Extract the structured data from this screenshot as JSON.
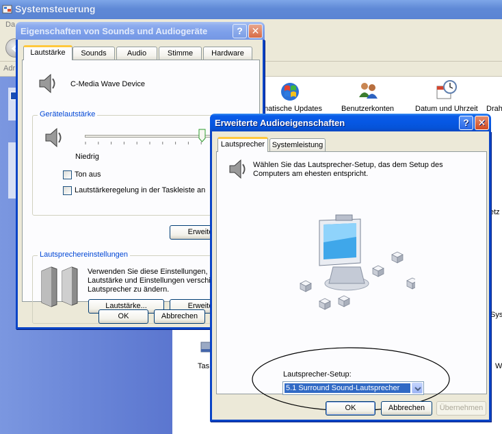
{
  "control_panel": {
    "title": "Systemsteuerung",
    "menu_partial": "Da",
    "address_partial": "Adr",
    "icons": [
      {
        "label": "matische Updates"
      },
      {
        "label": "Benutzerkonten"
      },
      {
        "label": "Datum und Uhrzeit"
      },
      {
        "label": "Drah"
      }
    ],
    "partial_labels": {
      "netz": "etz",
      "sys": "Sys",
      "tas": "Tas",
      "w": "W"
    }
  },
  "sound_dialog": {
    "title": "Eigenschaften von Sounds und Audiogeräte",
    "help_button": "?",
    "close_button": "✕",
    "tabs": [
      "Lautstärke",
      "Sounds",
      "Audio",
      "Stimme",
      "Hardware"
    ],
    "active_tab": "Lautstärke",
    "device_name": "C-Media Wave Device",
    "volume_group": {
      "legend": "Gerätelautstärke",
      "low_label": "Niedrig",
      "slider_level_percent": 90,
      "mute_label": "Ton aus",
      "mute_checked": false,
      "tray_label": "Lautstärkeregelung in der Taskleiste an",
      "tray_checked": false,
      "advanced_button": "Erweite"
    },
    "speaker_group": {
      "legend": "Lautsprechereinstellungen",
      "description_line1": "Verwenden Sie diese Einstellungen, u",
      "description_line2": "Lautstärke und Einstellungen verschie",
      "description_line3": "Lautsprecher zu ändern.",
      "volume_button": "Lautstärke...",
      "advanced_button": "Erweite"
    },
    "ok_button": "OK",
    "cancel_button": "Abbrechen"
  },
  "audio_dialog": {
    "title": "Erweiterte Audioeigenschaften",
    "help_button": "?",
    "close_button": "✕",
    "tabs": [
      "Lautsprecher",
      "Systemleistung"
    ],
    "active_tab": "Lautsprecher",
    "instruction_line1": "Wählen Sie das Lautsprecher-Setup, das dem Setup des",
    "instruction_line2": "Computers am ehesten entspricht.",
    "setup_label": "Lautsprecher-Setup:",
    "setup_value": "5.1 Surround Sound-Lautsprecher",
    "ok_button": "OK",
    "cancel_button": "Abbrechen",
    "apply_button": "Übernehmen",
    "apply_enabled": false
  },
  "colors": {
    "xp_title_blue": "#0553d8",
    "xp_border_blue": "#0a44c6",
    "dialog_face": "#ece9d8",
    "group_legend": "#0046d5",
    "highlight_oval": "#000000",
    "select_highlight": "#316ac5"
  }
}
